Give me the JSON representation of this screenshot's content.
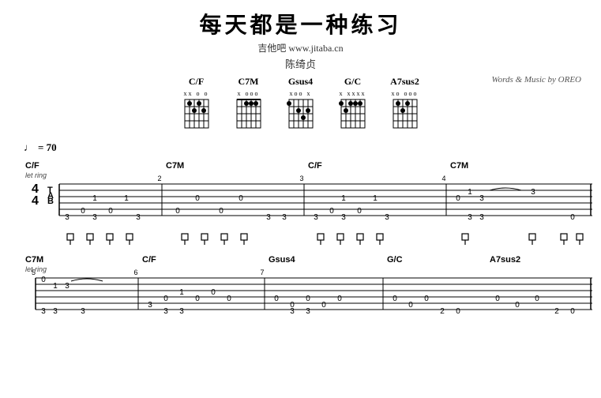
{
  "header": {
    "title": "每天都是一种练习",
    "subtitle": "吉他吧 www.jitaba.cn",
    "artist": "陈绮贞",
    "credits": "Words & Music by OREO"
  },
  "chords": [
    {
      "name": "C/F",
      "markers": "xx o o"
    },
    {
      "name": "C7M",
      "markers": "x  ooo"
    },
    {
      "name": "Gsus4",
      "markers": "xoo x"
    },
    {
      "name": "G/C",
      "markers": "x  xxxx"
    },
    {
      "name": "A7sus2",
      "markers": "xo ooo"
    }
  ],
  "tempo": {
    "symbol": "♩",
    "value": "= 70"
  },
  "section1": {
    "chords": [
      "C/F",
      "",
      "C7M",
      "",
      "C/F",
      "",
      "C7M"
    ],
    "letRing": "let ring",
    "timeSignature": "4/4"
  },
  "section2": {
    "chords": [
      "C7M",
      "",
      "C/F",
      "",
      "Gsus4",
      "",
      "G/C",
      "",
      "A7sus2"
    ],
    "letRing": "let ring"
  }
}
